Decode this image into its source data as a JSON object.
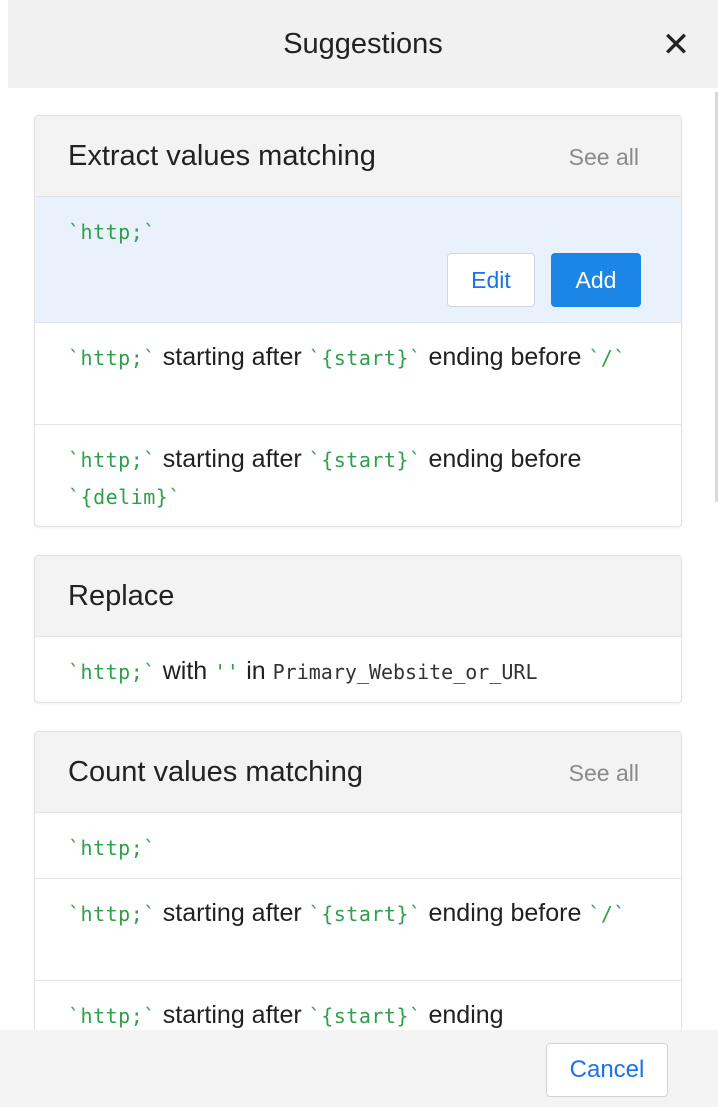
{
  "header": {
    "title": "Suggestions",
    "close_icon": "close-icon",
    "close_glyph": "✕"
  },
  "cards": [
    {
      "title": "Extract values matching",
      "see_all": "See all",
      "items": [
        {
          "code": "`http;`",
          "edit_label": "Edit",
          "add_label": "Add"
        },
        {
          "c1": "`http;`",
          "t1": " starting after ",
          "c2": "`{start}`",
          "t2": " ending before ",
          "c3": "`/`"
        },
        {
          "c1": "`http;`",
          "t1": " starting after ",
          "c2": "`{start}`",
          "t2": " ending before ",
          "c3": "`{delim}`"
        }
      ]
    },
    {
      "title": "Replace",
      "items": [
        {
          "c1": "`http;`",
          "t1": " with ",
          "c2": "''",
          "t2": " in ",
          "m1": "Primary_Website_or_URL"
        }
      ]
    },
    {
      "title": "Count values matching",
      "see_all": "See all",
      "items": [
        {
          "code": "`http;`"
        },
        {
          "c1": "`http;`",
          "t1": " starting after ",
          "c2": "`{start}`",
          "t2": " ending before ",
          "c3": "`/`"
        },
        {
          "c1": "`http;`",
          "t1": " starting after ",
          "c2": "`{start}`",
          "t2": " ending"
        }
      ]
    }
  ],
  "footer": {
    "cancel_label": "Cancel"
  }
}
